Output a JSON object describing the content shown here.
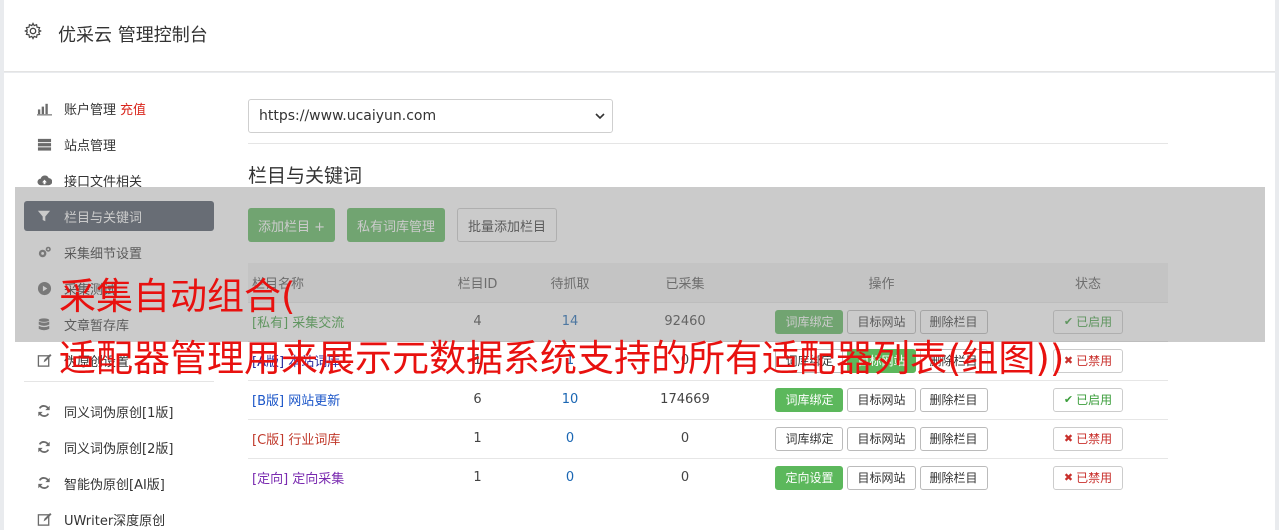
{
  "header": {
    "title": "优采云 管理控制台"
  },
  "sidebar": {
    "items": [
      {
        "label": "账户管理",
        "extra": "充值"
      },
      {
        "label": "站点管理"
      },
      {
        "label": "接口文件相关"
      },
      {
        "label": "栏目与关键词"
      },
      {
        "label": "采集细节设置"
      },
      {
        "label": "采集测试"
      },
      {
        "label": "文章暂存库"
      },
      {
        "label": "伪原创设置"
      },
      {
        "label": "同义词伪原创[1版]"
      },
      {
        "label": "同义词伪原创[2版]"
      },
      {
        "label": "智能伪原创[AI版]"
      },
      {
        "label": "UWriter深度原创"
      }
    ]
  },
  "site_select": {
    "value": "https://www.ucaiyun.com"
  },
  "section": {
    "title": "栏目与关键词"
  },
  "buttons": {
    "add_column": "添加栏目 +",
    "private_lib": "私有词库管理",
    "batch_add": "批量添加栏目"
  },
  "table": {
    "headers": [
      "栏目名称",
      "栏目ID",
      "待抓取",
      "已采集",
      "操作",
      "状态"
    ],
    "rows": [
      {
        "tag": "[私有]",
        "name": "采集交流",
        "id": "4",
        "pending": "14",
        "collected": "92460",
        "op1": "词库绑定",
        "op2": "目标网站",
        "op3": "删除栏目",
        "status": "已启用"
      },
      {
        "tag": "[A版]",
        "name": "本站词库",
        "id": "1",
        "pending": "1",
        "collected": "0",
        "op1": "词库绑定",
        "op2": "目标网站",
        "op3": "删除栏目",
        "status": "已禁用"
      },
      {
        "tag": "[B版]",
        "name": "网站更新",
        "id": "6",
        "pending": "10",
        "collected": "174669",
        "op1": "词库绑定",
        "op2": "目标网站",
        "op3": "删除栏目",
        "status": "已启用"
      },
      {
        "tag": "[C版]",
        "name": "行业词库",
        "id": "1",
        "pending": "0",
        "collected": "0",
        "op1": "词库绑定",
        "op2": "目标网站",
        "op3": "删除栏目",
        "status": "已禁用"
      },
      {
        "tag": "[定向]",
        "name": "定向采集",
        "id": "1",
        "pending": "0",
        "collected": "0",
        "op1": "定向设置",
        "op2": "目标网站",
        "op3": "删除栏目",
        "status": "已禁用"
      }
    ]
  },
  "watermark": {
    "line1": "采集自动组合(",
    "line2": "适配器管理用来展示元数据系统支持的所有适配器列表(组图))"
  },
  "colors": {
    "accent_green": "#5cb85c",
    "active_nav": "#4b5563",
    "recharge_red": "#d9251c",
    "watermark_red": "#e8110f"
  },
  "icons": [
    "gear-icon",
    "chart-icon",
    "server-icon",
    "cloud-upload-icon",
    "filter-icon",
    "cogs-icon",
    "play-icon",
    "database-icon",
    "edit-icon",
    "refresh-icon",
    "check-icon",
    "cross-icon"
  ]
}
